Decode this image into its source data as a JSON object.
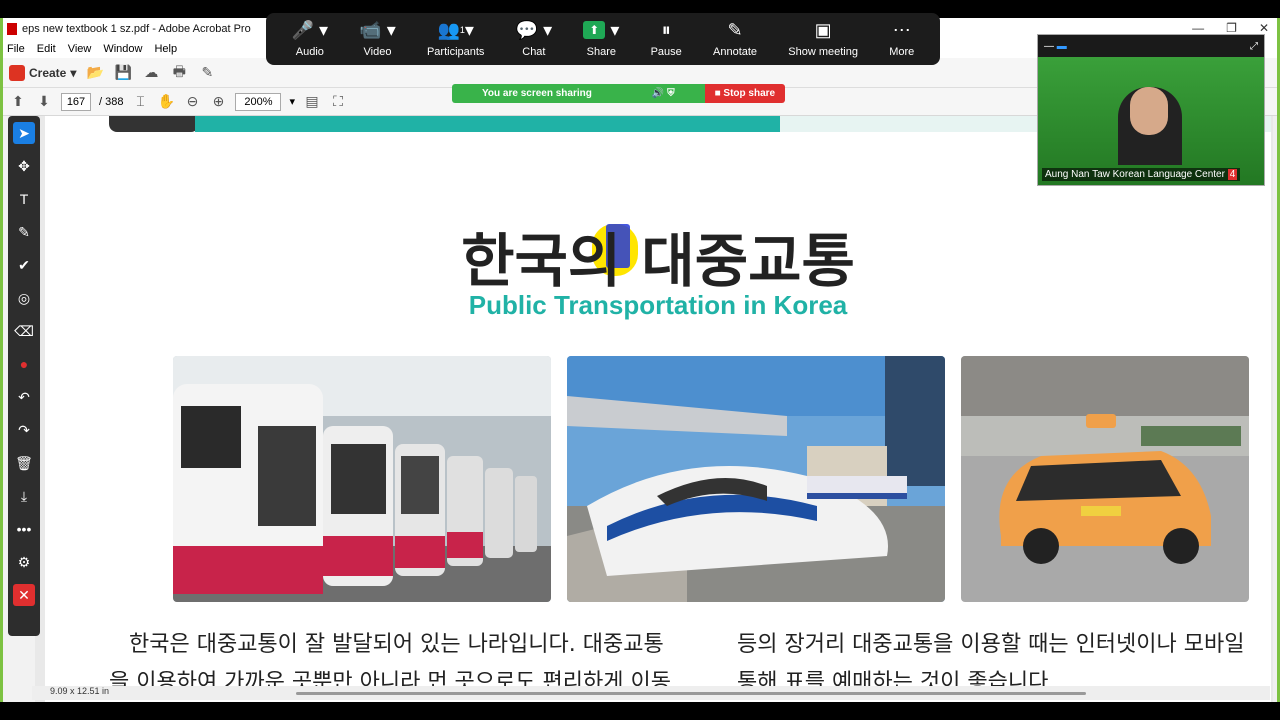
{
  "window": {
    "title": "eps new textbook 1 sz.pdf - Adobe Acrobat Pro",
    "controls": [
      "—",
      "❐",
      "✕"
    ]
  },
  "menu": [
    "File",
    "Edit",
    "View",
    "Window",
    "Help"
  ],
  "toolbar": {
    "create_label": "Create",
    "page_current": "167",
    "page_total": "/ 388",
    "zoom": "200%"
  },
  "zoom_bar": {
    "items": [
      {
        "label": "Audio",
        "icon": "microphone-icon",
        "glyph": "🎤"
      },
      {
        "label": "Video",
        "icon": "video-camera-icon",
        "glyph": "📹"
      },
      {
        "label": "Participants",
        "icon": "participants-icon",
        "glyph": "👥",
        "badge": "1"
      },
      {
        "label": "Chat",
        "icon": "chat-icon",
        "glyph": "💬"
      },
      {
        "label": "Share",
        "icon": "share-icon",
        "glyph": "⬆"
      },
      {
        "label": "Pause",
        "icon": "pause-icon",
        "glyph": "⏸"
      },
      {
        "label": "Annotate",
        "icon": "pen-icon",
        "glyph": "✎"
      },
      {
        "label": "Show meeting",
        "icon": "window-icon",
        "glyph": "▣"
      },
      {
        "label": "More",
        "icon": "more-icon",
        "glyph": "⋯"
      }
    ],
    "sharing_text": "You are screen sharing",
    "stop_share": "Stop share"
  },
  "video_panel": {
    "name": "Aung Nan Taw Korean Language Center",
    "badge": "4"
  },
  "document": {
    "korean_title": "한국의 대중교통",
    "english_title": "Public Transportation in Korea",
    "body_left_1": "한국은 대중교통이 잘 발달되어 있는 나라입니다. 대중교통",
    "body_left_2": "을 이용하여 가까운 곳뿐만 아니라 먼 곳으로도 편리하게 이동",
    "body_right_1": "등의 장거리 대중교통을 이용할 때는 인터넷이나 모바일",
    "body_right_2": "통해 표를 예매하는 것이 좋습니다."
  },
  "status": {
    "page_size": "9.09 x 12.51 in"
  },
  "colors": {
    "teal": "#20b2a6",
    "zoom_bar": "#1c1c1c",
    "share_green": "#39b34a",
    "stop_red": "#e02f2f",
    "frame_green": "#7dc242"
  }
}
